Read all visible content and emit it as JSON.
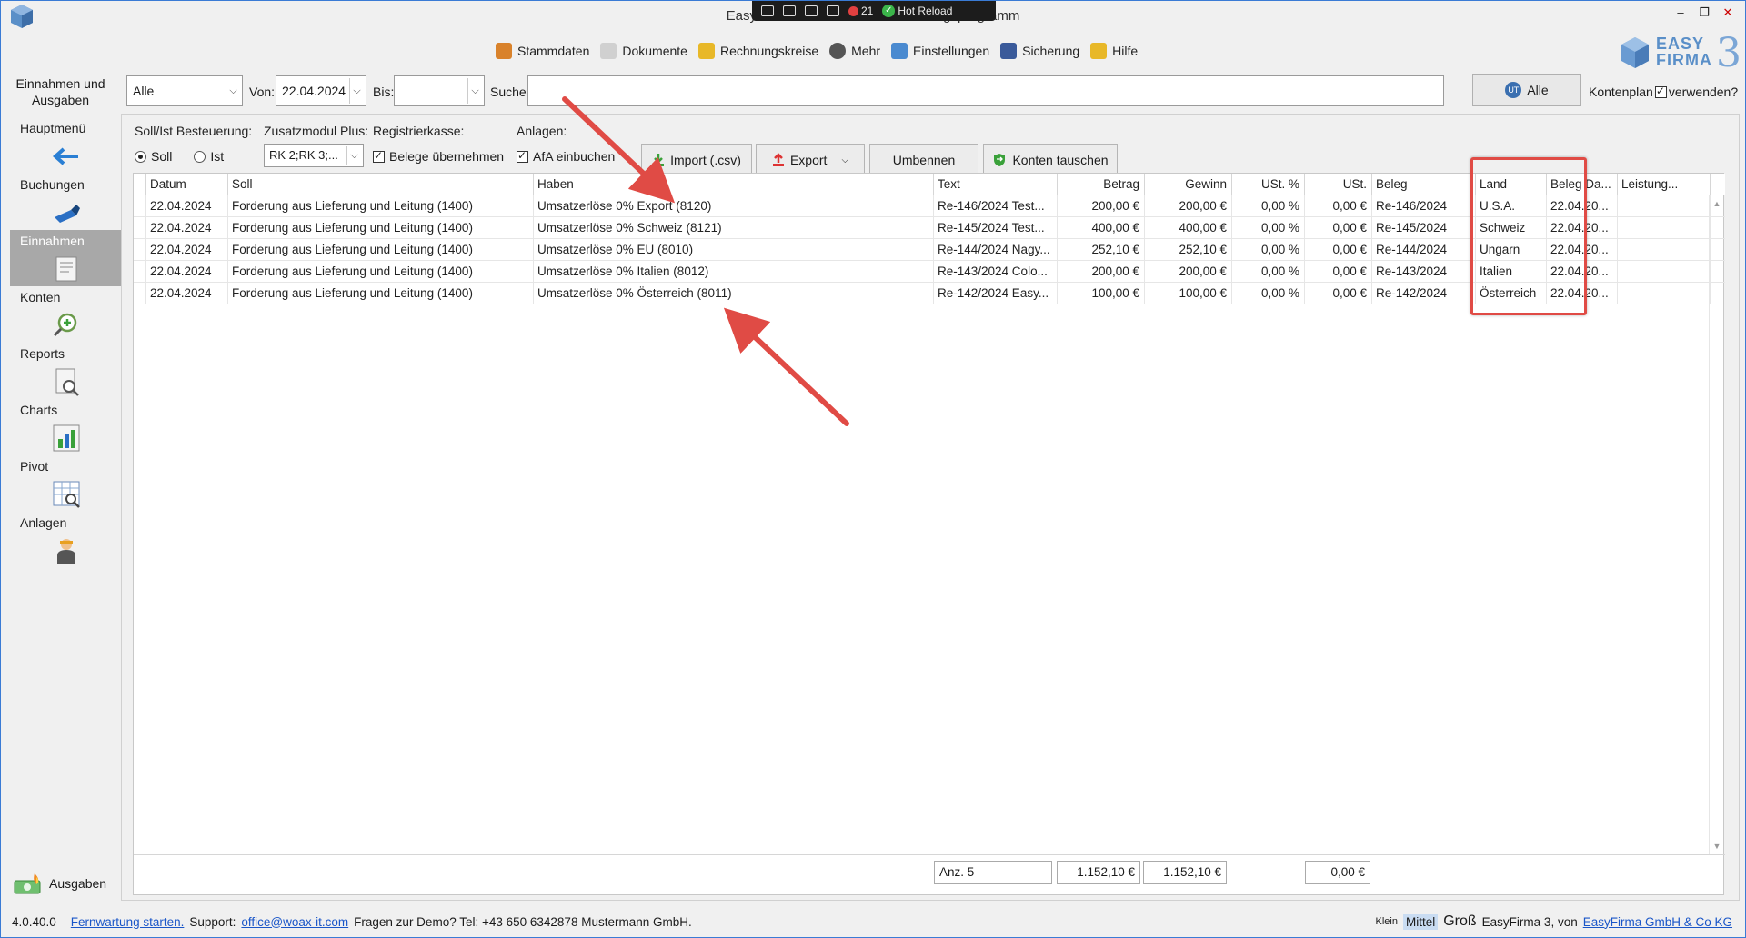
{
  "window": {
    "title": "EasyFirma 3 - das neue Buchhaltungsprogramm"
  },
  "hotreload": {
    "count": "21",
    "label": "Hot Reload"
  },
  "menu": [
    {
      "label": "Stammdaten",
      "icon": "stammdaten-icon",
      "color": "#d9822b"
    },
    {
      "label": "Dokumente",
      "icon": "document-icon",
      "color": "#d0d0d0"
    },
    {
      "label": "Rechnungskreise",
      "icon": "rechnungskreise-icon",
      "color": "#e8b828"
    },
    {
      "label": "Mehr",
      "icon": "more-icon",
      "color": "#555555"
    },
    {
      "label": "Einstellungen",
      "icon": "gear-icon",
      "color": "#4a8ad0"
    },
    {
      "label": "Sicherung",
      "icon": "floppy-icon",
      "color": "#3a5a9a"
    },
    {
      "label": "Hilfe",
      "icon": "help-icon",
      "color": "#e8b828"
    }
  ],
  "logo": {
    "line1": "EASY",
    "line2": "FIRMA",
    "num": "3"
  },
  "sidebar": {
    "title": "Einnahmen und Ausgaben",
    "items": [
      {
        "label": "Hauptmenü",
        "icon": "arrow-left-icon"
      },
      {
        "label": "Buchungen",
        "icon": "buchungen-icon"
      },
      {
        "label": "Einnahmen",
        "icon": "einnahmen-icon",
        "active": true
      },
      {
        "label": "Konten",
        "icon": "konten-search-icon"
      },
      {
        "label": "Reports",
        "icon": "reports-icon"
      },
      {
        "label": "Charts",
        "icon": "charts-icon"
      },
      {
        "label": "Pivot",
        "icon": "pivot-icon"
      },
      {
        "label": "Anlagen",
        "icon": "anlagen-icon"
      }
    ],
    "ausgaben": "Ausgaben"
  },
  "filter": {
    "scope_value": "Alle",
    "von_label": "Von:",
    "von_value": "22.04.2024",
    "bis_label": "Bis:",
    "bis_value": "",
    "suche_label": "Suche:",
    "suche_value": "",
    "alle_button": "Alle",
    "alle_icon_text": "UT",
    "kontenplan_label": "Kontenplan",
    "verwenden_label": "verwenden?"
  },
  "options": {
    "sollist_label": "Soll/Ist Besteuerung:",
    "soll": "Soll",
    "ist": "Ist",
    "zusatz_label": "Zusatzmodul Plus:",
    "zusatz_value": "RK 2;RK 3;...",
    "registrierkasse_label": "Registrierkasse:",
    "belege_label": "Belege übernehmen",
    "anlagen_label": "Anlagen:",
    "afa_label": "AfA einbuchen"
  },
  "toolbar": {
    "import": "Import (.csv)",
    "export": "Export",
    "umbennen": "Umbennen",
    "konten_tauschen": "Konten tauschen"
  },
  "columns": [
    "Datum",
    "Soll",
    "Haben",
    "Text",
    "Betrag",
    "Gewinn",
    "USt. %",
    "USt.",
    "Beleg",
    "Land",
    "Beleg Da...",
    "Leistung..."
  ],
  "rows": [
    [
      "22.04.2024",
      "Forderung aus Lieferung und Leitung (1400)",
      "Umsatzerlöse 0% Export (8120)",
      "Re-146/2024 Test...",
      "200,00 €",
      "200,00 €",
      "0,00 %",
      "0,00 €",
      "Re-146/2024",
      "U.S.A.",
      "22.04.20...",
      ""
    ],
    [
      "22.04.2024",
      "Forderung aus Lieferung und Leitung (1400)",
      "Umsatzerlöse 0% Schweiz (8121)",
      "Re-145/2024 Test...",
      "400,00 €",
      "400,00 €",
      "0,00 %",
      "0,00 €",
      "Re-145/2024",
      "Schweiz",
      "22.04.20...",
      ""
    ],
    [
      "22.04.2024",
      "Forderung aus Lieferung und Leitung (1400)",
      "Umsatzerlöse 0% EU (8010)",
      "Re-144/2024 Nagy...",
      "252,10 €",
      "252,10 €",
      "0,00 %",
      "0,00 €",
      "Re-144/2024",
      "Ungarn",
      "22.04.20...",
      ""
    ],
    [
      "22.04.2024",
      "Forderung aus Lieferung und Leitung (1400)",
      "Umsatzerlöse 0% Italien (8012)",
      "Re-143/2024 Colo...",
      "200,00 €",
      "200,00 €",
      "0,00 %",
      "0,00 €",
      "Re-143/2024",
      "Italien",
      "22.04.20...",
      ""
    ],
    [
      "22.04.2024",
      "Forderung aus Lieferung und Leitung (1400)",
      "Umsatzerlöse 0% Österreich (8011)",
      "Re-142/2024 Easy...",
      "100,00 €",
      "100,00 €",
      "0,00 %",
      "0,00 €",
      "Re-142/2024",
      "Österreich",
      "22.04.20...",
      ""
    ]
  ],
  "totals": {
    "count": "Anz. 5",
    "betrag": "1.152,10 €",
    "gewinn": "1.152,10 €",
    "ust": "0,00 €"
  },
  "status": {
    "version": "4.0.40.0",
    "fernwartung": "Fernwartung starten.",
    "support": "Support:",
    "email": "office@woax-it.com",
    "demo": "Fragen zur Demo? Tel: +43 650 6342878 Mustermann GmbH.",
    "klein": "Klein",
    "mittel": "Mittel",
    "gross": "Groß",
    "by": "EasyFirma 3, von",
    "company": "EasyFirma GmbH & Co KG"
  },
  "colors": {
    "highlight": "#e04b45",
    "accent": "#3a7bd5",
    "link": "#1a56c8",
    "active_nav": "#a8a8a8"
  }
}
